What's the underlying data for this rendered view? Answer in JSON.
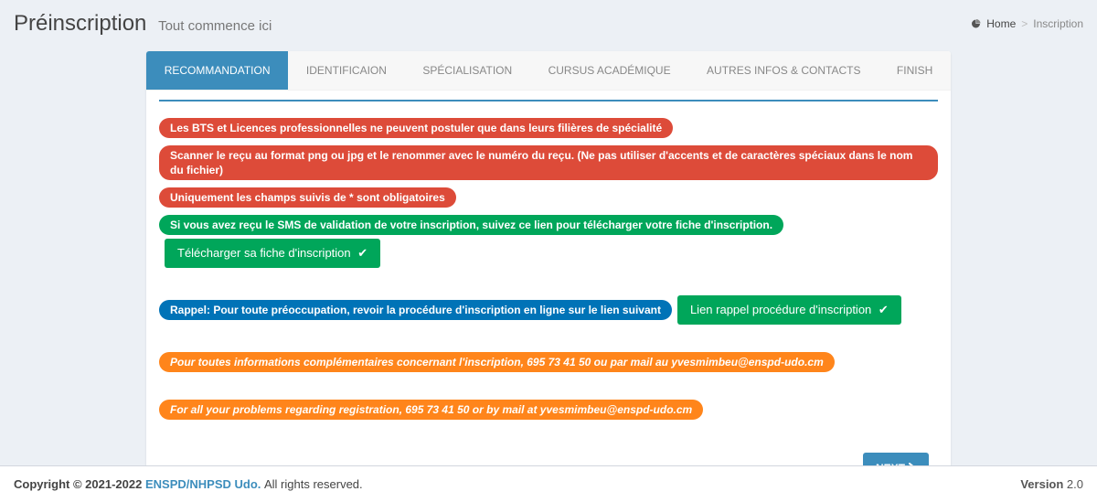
{
  "header": {
    "title": "Préinscription",
    "subtitle": "Tout commence ici"
  },
  "breadcrumb": {
    "home": "Home",
    "current": "Inscription"
  },
  "tabs": [
    {
      "label": "RECOMMANDATION",
      "active": true
    },
    {
      "label": "IDENTIFICAION",
      "active": false
    },
    {
      "label": "SPÉCIALISATION",
      "active": false
    },
    {
      "label": "CURSUS ACADÉMIQUE",
      "active": false
    },
    {
      "label": "AUTRES INFOS & CONTACTS",
      "active": false
    },
    {
      "label": "FINISH",
      "active": false
    }
  ],
  "messages": {
    "red1": "Les BTS et Licences professionnelles ne peuvent postuler que dans leurs filières de spécialité",
    "red2": "Scanner le reçu au format png ou jpg et le renommer avec le numéro du reçu. (Ne pas utiliser d'accents et de caractères spéciaux dans le nom du fichier)",
    "red3": "Uniquement les champs suivis de * sont obligatoires",
    "green1": "Si vous avez reçu le SMS de validation de votre inscription, suivez ce lien pour télécharger votre fiche d'inscription.",
    "btn_dl": "Télécharger sa fiche d'inscription",
    "blue1": "Rappel: Pour toute préoccupation, revoir la procédure d'inscription en ligne sur le lien suivant",
    "btn_proc": "Lien rappel procédure d'inscription",
    "orange1": "Pour toutes informations complémentaires concernant l'inscription, 695 73 41 50 ou par mail au yvesmimbeu@enspd-udo.cm",
    "orange2": "For all your problems regarding registration, 695 73 41 50 or by mail at yvesmimbeu@enspd-udo.cm"
  },
  "next_label": "NEXT",
  "footer": {
    "copyright_prefix": "Copyright © 2021-2022 ",
    "org": "ENSPD/NHPSD Udo.",
    "copyright_suffix": " All rights reserved.",
    "version_label": "Version",
    "version": " 2.0"
  }
}
